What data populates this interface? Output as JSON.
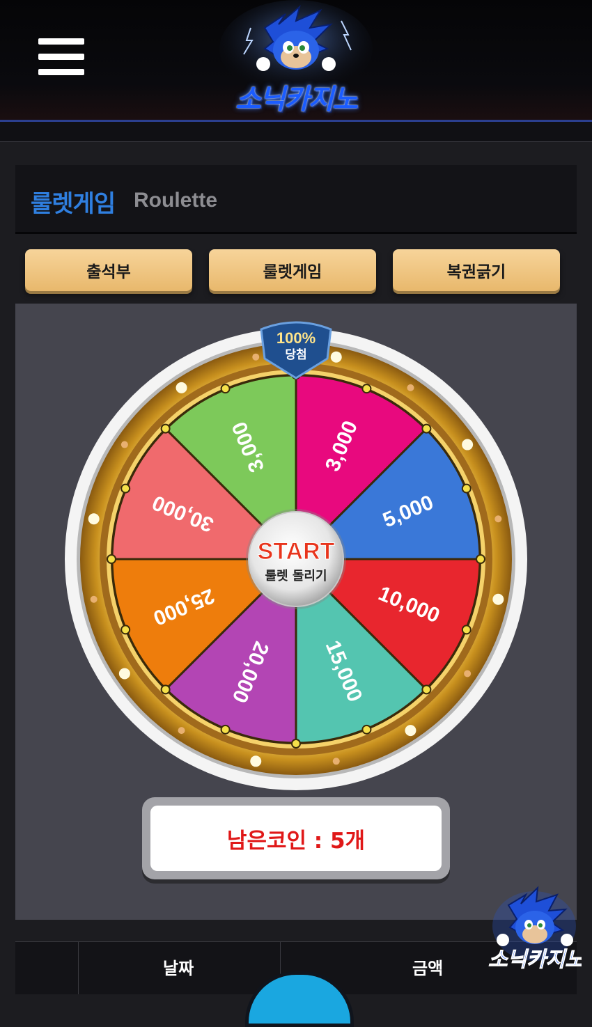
{
  "header": {
    "logo_text": "소닉카지노",
    "menu_icon": "hamburger-menu-icon"
  },
  "page_title": {
    "korean": "룰렛게임",
    "english": "Roulette"
  },
  "tabs": [
    {
      "label": "출석부"
    },
    {
      "label": "룰렛게임"
    },
    {
      "label": "복권긁기"
    }
  ],
  "roulette": {
    "badge_top": "100%",
    "badge_bottom": "당첨",
    "start_label": "START",
    "start_sub": "룰렛 돌리기",
    "segments": [
      {
        "label": "3,000",
        "color": "#e8097e"
      },
      {
        "label": "5,000",
        "color": "#3a78d8"
      },
      {
        "label": "10,000",
        "color": "#e8262e"
      },
      {
        "label": "15,000",
        "color": "#54c5b0"
      },
      {
        "label": "20,000",
        "color": "#b345b4"
      },
      {
        "label": "25,000",
        "color": "#ee7d0c"
      },
      {
        "label": "30,000",
        "color": "#f06a6d"
      },
      {
        "label": "3,000",
        "color": "#7dc95a"
      }
    ]
  },
  "coins": {
    "label": "남은코인 : 5개"
  },
  "history_table": {
    "columns": [
      "날짜",
      "금액"
    ]
  },
  "colors": {
    "accent_blue": "#2f7fe0",
    "tab_gold": "#f0c47f",
    "coin_red": "#e01818"
  }
}
